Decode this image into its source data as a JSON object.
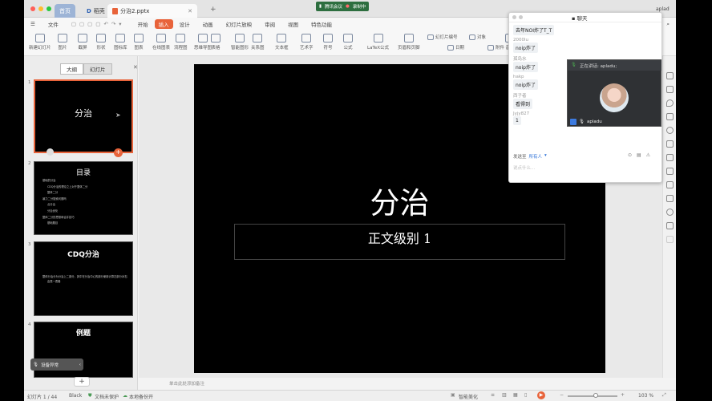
{
  "titlebar": {
    "home_tab": "首页",
    "daoke_tab": "稻壳",
    "doc_tab": "分治2.pptx",
    "meeting_label": "腾讯会议",
    "recording_label": "录制中",
    "user_name": "aplad"
  },
  "menu": {
    "file": "文件",
    "items": [
      "开始",
      "插入",
      "设计",
      "动画",
      "幻灯片放映",
      "审阅",
      "视图",
      "特色功能"
    ]
  },
  "ribbon": {
    "items": [
      "新建幻灯片",
      "图片",
      "截屏",
      "形状",
      "图标库",
      "图表",
      "在线图表",
      "流程图",
      "思维导图",
      "表格",
      "智能图形",
      "关系图",
      "文本框",
      "艺术字",
      "符号",
      "公式",
      "LaTeX公式",
      "页眉和页脚",
      "幻灯片编号",
      "日期",
      "对象",
      "附件",
      "音频"
    ]
  },
  "left_panel": {
    "outline_tab": "大纲",
    "slides_tab": "幻灯片",
    "thumb1_title": "分治",
    "thumb2_title": "目录",
    "thumb2_lines": [
      "基础的分治",
      "CDQ分治的理论之上对于整体二分",
      "整体二分",
      "暴力二分搜索问题吗",
      "点分治",
      "分治优化",
      "整体二分的思想和合并技巧",
      "基础题目"
    ],
    "thumb3_title": "CDQ分治",
    "thumb3_lines": [
      "整体分治分为分治上二部分，其中在分治中心的部分使用计算左部分对右部分的影响",
      "由表一表格"
    ],
    "thumb4_title": "例题",
    "add_label": "+",
    "mic_note": "设备异常"
  },
  "slide": {
    "title": "分治",
    "subtitle": "正文级别 1"
  },
  "chat": {
    "header": "聊天",
    "messages": [
      {
        "name": "",
        "text": "去年NOI炸了T_T"
      },
      {
        "name": "2000lu",
        "text": "noip炸了"
      },
      {
        "name": "孤岛水",
        "text": "noip炸了"
      },
      {
        "name": "hakp",
        "text": "noip炸了"
      },
      {
        "name": "西子者",
        "text": "看得到"
      },
      {
        "name": "Jyjy827",
        "text": "1"
      }
    ],
    "send_to_label": "发送至",
    "send_to_value": "所有人",
    "input_placeholder": "说点什么...",
    "speaking_label": "正在讲话: apladu;",
    "video_user": "apladu"
  },
  "status": {
    "slide_counter": "幻灯片 1 / 44",
    "theme": "Black",
    "doc_protect": "文档未保护",
    "backup": "本地备份开",
    "notes_placeholder": "单击此处添加备注",
    "smart_beautify": "智能美化",
    "zoom": "103 %"
  },
  "colors": {
    "accent": "#e8633a",
    "slide_bg": "#000000"
  }
}
